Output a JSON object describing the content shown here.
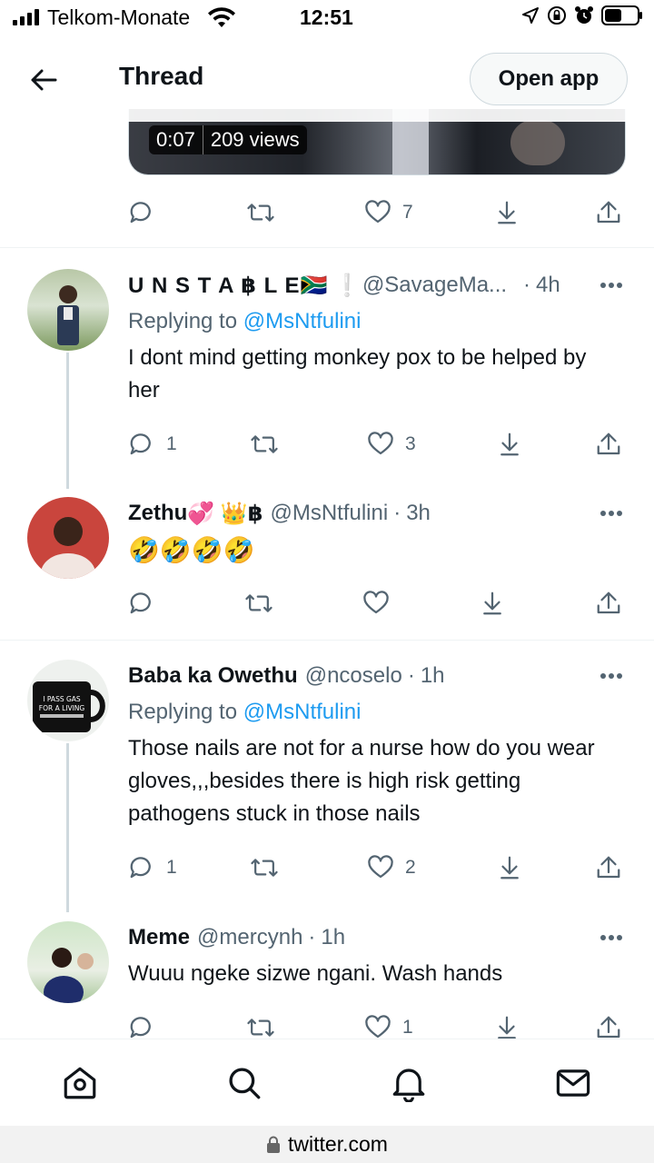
{
  "status_bar": {
    "carrier": "Telkom-Monate",
    "time": "12:51"
  },
  "header": {
    "title": "Thread",
    "open_app": "Open app"
  },
  "media": {
    "duration": "0:07",
    "views": "209 views"
  },
  "main_actions": {
    "likes": "7"
  },
  "tweets": [
    {
      "name": "U N S T A ฿ L E",
      "name_emoji": "🇿🇦 ❕",
      "handle": "@SavageMa...",
      "time": "4h",
      "replying_prefix": "Replying to",
      "replying_to": "@MsNtfulini",
      "text": "I dont mind getting monkey pox to be helped by her",
      "replies": "1",
      "retweets": "",
      "likes": "3"
    },
    {
      "name": "Zethu",
      "name_emoji": "💞 👑",
      "name_suffix": "฿",
      "handle": "@MsNtfulini",
      "time": "3h",
      "text": "🤣🤣🤣🤣",
      "replies": "",
      "retweets": "",
      "likes": ""
    },
    {
      "name": "Baba ka Owethu",
      "handle": "@ncoselo",
      "time": "1h",
      "replying_prefix": "Replying to",
      "replying_to": "@MsNtfulini",
      "text": "Those nails are not for a nurse how do you wear gloves,,,besides there is high risk getting pathogens stuck in those nails",
      "replies": "1",
      "retweets": "",
      "likes": "2",
      "avatar_text": "I PASS GAS FOR A LIVING"
    },
    {
      "name": "Meme",
      "handle": "@mercynh",
      "time": "1h",
      "text": "Wuuu ngeke sizwe ngani. Wash hands",
      "replies": "",
      "retweets": "",
      "likes": "1"
    }
  ],
  "bottom_nav": [
    "home-icon",
    "search-icon",
    "bell-icon",
    "mail-icon"
  ],
  "url_bar": {
    "url": "twitter.com"
  },
  "colors": {
    "accent": "#1d9bf0",
    "text": "#0f1419",
    "muted": "#536471"
  }
}
